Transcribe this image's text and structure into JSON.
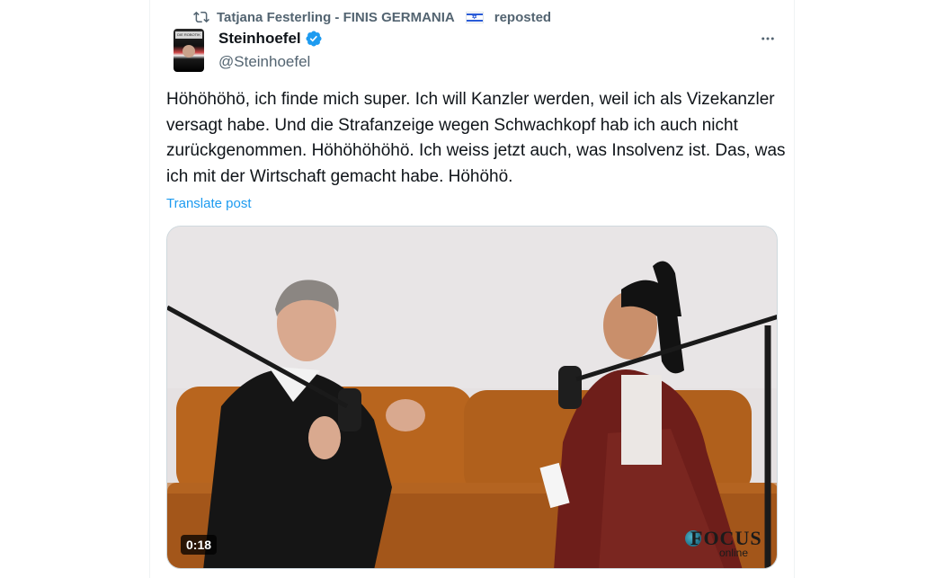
{
  "repost": {
    "user": "Tatjana Festerling - FINIS GERMANIA",
    "flag": "israel-flag",
    "label": "reposted"
  },
  "author": {
    "name": "Steinhoefel",
    "handle": "@Steinhoefel",
    "verified": true,
    "avatar_label": "DIE ROBOTIK"
  },
  "tweet": {
    "text": "Höhöhöhö, ich finde mich super. Ich will Kanzler werden, weil ich als Vizekanzler versagt habe. Und die Strafanzeige wegen Schwachkopf hab ich auch nicht zurückgenommen. Höhöhöhöhö. Ich weiss jetzt auch, was Insolvenz ist. Das, was ich mit der Wirtschaft gemacht habe. Höhöhö.",
    "translate_label": "Translate post"
  },
  "media": {
    "duration": "0:18",
    "watermark": "FOCUS",
    "watermark_sub": "online"
  },
  "colors": {
    "accent": "#1d9bf0",
    "secondary_text": "#536471",
    "primary_text": "#0f1419"
  }
}
